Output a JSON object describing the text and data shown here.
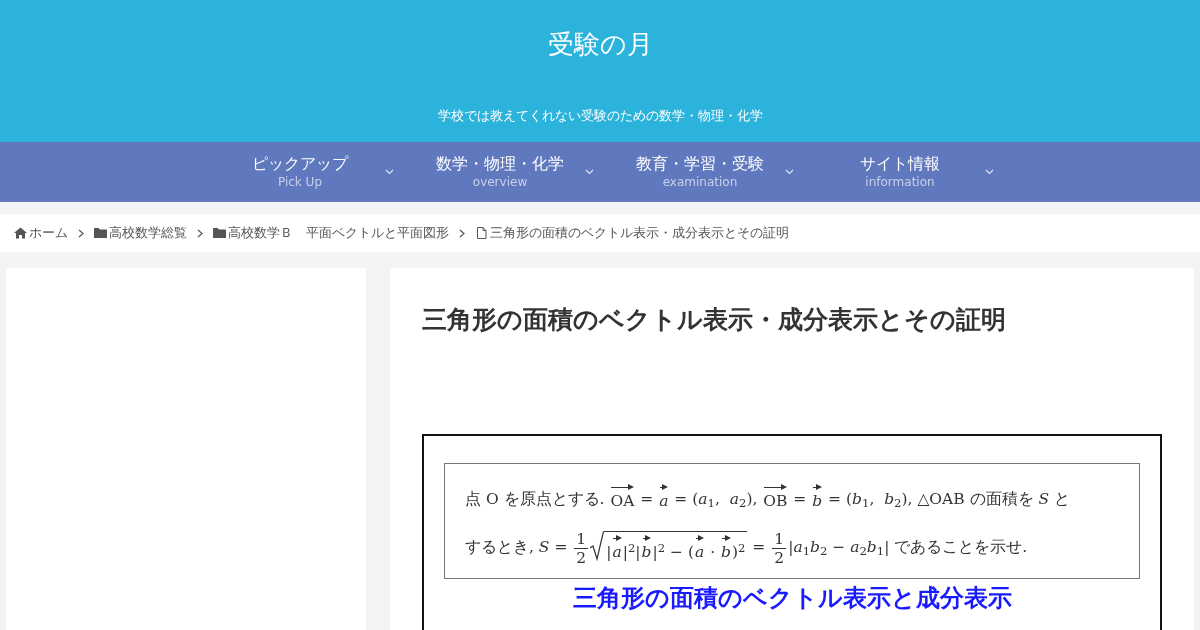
{
  "site": {
    "title": "受験の月",
    "tagline": "学校では教えてくれない受験のための数学・物理・化学"
  },
  "nav": [
    {
      "label": "ピックアップ",
      "sub": "Pick Up"
    },
    {
      "label": "数学・物理・化学",
      "sub": "overview"
    },
    {
      "label": "教育・学習・受験",
      "sub": "examination"
    },
    {
      "label": "サイト情報",
      "sub": "information"
    }
  ],
  "breadcrumb": [
    {
      "kind": "home",
      "label": "ホーム"
    },
    {
      "kind": "folder",
      "label": "高校数学総覧"
    },
    {
      "kind": "folder",
      "label": "高校数学Ｂ　平面ベクトルと平面図形"
    },
    {
      "kind": "page",
      "label": "三角形の面積のベクトル表示・成分表示とその証明"
    }
  ],
  "article": {
    "title": "三角形の面積のベクトル表示・成分表示とその証明",
    "problem": [
      [
        {
          "kind": "text",
          "text": "点 O を原点とする. "
        },
        {
          "kind": "vec",
          "text": "OA"
        },
        {
          "kind": "text",
          "text": " = "
        },
        {
          "kind": "vec",
          "text": "*a*"
        },
        {
          "kind": "text",
          "text": " = (*a*$_{1}$,  *a*$_{2}$), "
        },
        {
          "kind": "vec",
          "text": "OB"
        },
        {
          "kind": "text",
          "text": " = "
        },
        {
          "kind": "vec",
          "text": "*b*"
        },
        {
          "kind": "text",
          "text": " = (*b*$_{1}$,  *b*$_{2}$), △OAB の面積を *S* と"
        }
      ],
      [
        {
          "kind": "text",
          "text": "するとき, *S* = "
        },
        {
          "kind": "frac",
          "num": "1",
          "den": "2"
        },
        {
          "kind": "sqrt",
          "parts": [
            {
              "kind": "text",
              "text": "|"
            },
            {
              "kind": "vec",
              "text": "*a*"
            },
            {
              "kind": "text",
              "text": "|$^{2}$|"
            },
            {
              "kind": "vec",
              "text": "*b*"
            },
            {
              "kind": "text",
              "text": "|$^{2}$ − ("
            },
            {
              "kind": "vec",
              "text": "*a*"
            },
            {
              "kind": "text",
              "text": " · "
            },
            {
              "kind": "vec",
              "text": "*b*"
            },
            {
              "kind": "text",
              "text": ")$^{2}$"
            }
          ]
        },
        {
          "kind": "text",
          "text": " = "
        },
        {
          "kind": "frac",
          "num": "1",
          "den": "2"
        },
        {
          "kind": "text",
          "text": "|*a*$_{1}$*b*$_{2}$ − *a*$_{2}$*b*$_{1}$| であることを示せ."
        }
      ]
    ],
    "heading": "三角形の面積のベクトル表示と成分表示"
  }
}
